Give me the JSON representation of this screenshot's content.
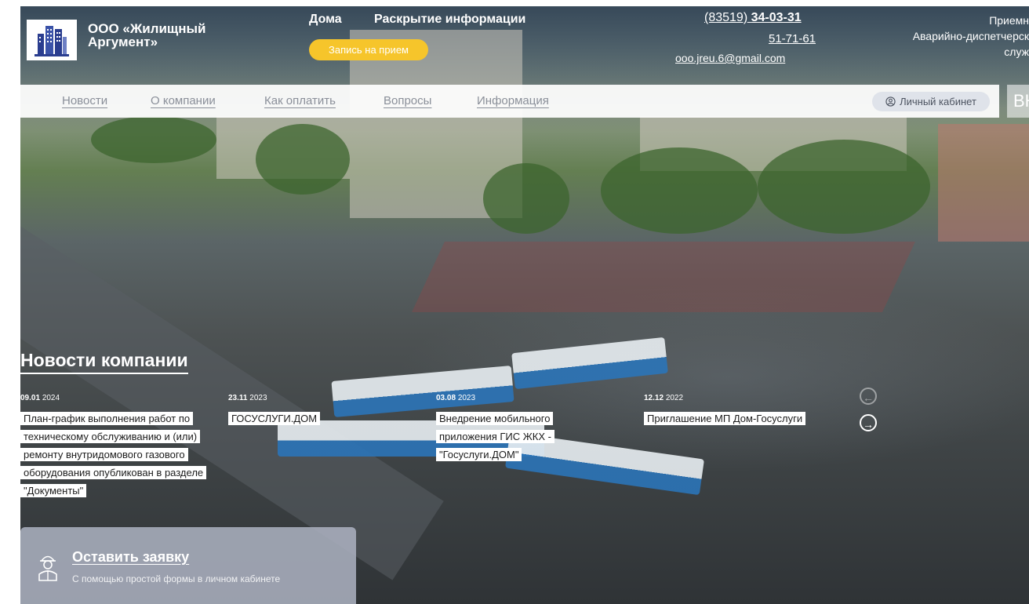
{
  "header": {
    "logo_icon": "building-logo-icon",
    "company_name": "ООО «Жилищный Аргумент»",
    "nav_top": [
      "Дома",
      "Раскрытие информации"
    ],
    "appointment_button": "Запись на прием",
    "phone_prefix": "(83519)",
    "phone_main": "34-03-31",
    "phone_secondary": "51-71-61",
    "email": "ooo.jreu.6@gmail.com",
    "right_line1": "Приемн",
    "right_line2": "Аварийно-диспетчерск",
    "right_line3": "служ"
  },
  "navbar": {
    "items": [
      "Новости",
      "О компании",
      "Как оплатить",
      "Вопросы",
      "Информация"
    ],
    "cabinet_label": "Личный кабинет",
    "cabinet_icon": "user-circle-icon",
    "social_label": "ВК"
  },
  "news": {
    "title": "Новости компании",
    "items": [
      {
        "date_day": "09.01",
        "date_year": "2024",
        "text": "План-график выполнения работ по техническому обслуживанию и (или) ремонту внутридомового газового оборудования опубликован в разделе \"Документы\""
      },
      {
        "date_day": "23.11",
        "date_year": "2023",
        "text": "ГОСУСЛУГИ.ДОМ"
      },
      {
        "date_day": "03.08",
        "date_year": "2023",
        "text": "Внедрение мобильного приложения ГИС ЖКХ - \"Госуслуги.ДОМ\""
      },
      {
        "date_day": "12.12",
        "date_year": "2022",
        "text": "Приглашение МП Дом-Госуслуги"
      }
    ],
    "prev_icon": "arrow-left-icon",
    "next_icon": "arrow-right-icon"
  },
  "request": {
    "icon": "worker-icon",
    "title": "Оставить заявку",
    "subtitle": "С помощью простой формы в личном кабинете"
  },
  "colors": {
    "accent_yellow": "#f6c52b",
    "navbar_bg": "#ffffff",
    "nav_text": "#8a8f99",
    "request_bg": "#aab0be"
  }
}
